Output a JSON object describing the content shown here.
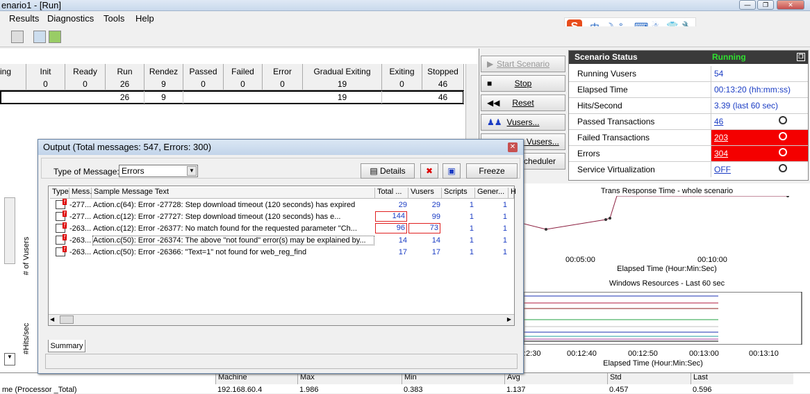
{
  "window": {
    "title": "enario1 - [Run]"
  },
  "menu": [
    "Results",
    "Diagnostics",
    "Tools",
    "Help"
  ],
  "ime": {
    "logo": "S",
    "chars": [
      "中",
      "☽",
      "°,",
      "⌨",
      "☃",
      "👕",
      "🔧"
    ]
  },
  "groups": {
    "columns": [
      {
        "name": "ing",
        "value": ""
      },
      {
        "name": "Init",
        "value": "0"
      },
      {
        "name": "Ready",
        "value": "0"
      },
      {
        "name": "Run",
        "value": "26"
      },
      {
        "name": "Rendez",
        "value": "9"
      },
      {
        "name": "Passed",
        "value": "0"
      },
      {
        "name": "Failed",
        "value": "0"
      },
      {
        "name": "Error",
        "value": "0"
      },
      {
        "name": "Gradual Exiting",
        "value": "19"
      },
      {
        "name": "Exiting",
        "value": "0"
      },
      {
        "name": "Stopped",
        "value": "46"
      }
    ],
    "row": {
      "run": "26",
      "rendez": "9",
      "gradual": "19",
      "stopped": "46"
    }
  },
  "controls": {
    "start": "Start Scenario",
    "stop": "Stop",
    "reset": "Reset",
    "vusers": "Vusers...",
    "runstop": "op Vusers...",
    "scheduler": "Scheduler"
  },
  "status": {
    "title": "Scenario Status",
    "state": "Running",
    "rows": [
      {
        "key": "Running Vusers",
        "val": "54"
      },
      {
        "key": "Elapsed Time",
        "val": "00:13:20 (hh:mm:ss)"
      },
      {
        "key": "Hits/Second",
        "val": "3.39 (last 60 sec)"
      },
      {
        "key": "Passed Transactions",
        "val": "46"
      },
      {
        "key": "Failed Transactions",
        "val": "203"
      },
      {
        "key": "Errors",
        "val": "304"
      },
      {
        "key": "Service Virtualization",
        "val": "OFF"
      }
    ]
  },
  "left": {
    "vusers_label": "# of Vusers",
    "hits_label": "#Hits/sec"
  },
  "graph1": {
    "title": "Trans Response Time - whole scenario",
    "ticks": [
      "00:05:00",
      "00:10:00"
    ],
    "xlabel": "Elapsed Time (Hour:Min:Sec)"
  },
  "graph2": {
    "title": "Windows Resources - Last 60 sec",
    "ticks": [
      ":2:30",
      "00:12:40",
      "00:12:50",
      "00:13:00",
      "00:13:10"
    ],
    "xlabel": "Elapsed Time (Hour:Min:Sec)"
  },
  "output": {
    "title": "Output (Total messages: 547,  Errors: 300)",
    "type_label": "Type of Message:",
    "type_value": "Errors",
    "details": "Details",
    "freeze": "Freeze",
    "headers": [
      "Type",
      "Mess...",
      "Sample Message Text",
      "Total ...",
      "Vusers",
      "Scripts",
      "Gener...",
      "H"
    ],
    "rows": [
      {
        "id": "-277...",
        "text": "Action.c(64): Error -27728: Step download timeout (120 seconds) has expired",
        "total": "29",
        "vusers": "29",
        "scripts": "1",
        "gen": "1"
      },
      {
        "id": "-277...",
        "text": "Action.c(12): Error -27727: Step download timeout (120 seconds) has e...",
        "total": "144",
        "vusers": "99",
        "scripts": "1",
        "gen": "1"
      },
      {
        "id": "-263...",
        "text": "Action.c(12): Error -26377: No match found for the requested parameter \"Ch...",
        "total": "96",
        "vusers": "73",
        "scripts": "1",
        "gen": "1"
      },
      {
        "id": "-263...",
        "text": "Action.c(50): Error -26374: The above \"not found\" error(s) may be explained by...",
        "total": "14",
        "vusers": "14",
        "scripts": "1",
        "gen": "1"
      },
      {
        "id": "-263...",
        "text": "Action.c(50): Error -26366: \"Text=1\" not found for web_reg_find",
        "total": "17",
        "vusers": "17",
        "scripts": "1",
        "gen": "1"
      }
    ],
    "tab": "Summary"
  },
  "measures": {
    "headers": [
      "Machine",
      "Max",
      "Min",
      "Avg",
      "Std",
      "Last"
    ],
    "row": {
      "name": "me (Processor _Total)",
      "machine": "192.168.60.4",
      "max": "1.986",
      "min": "0.383",
      "avg": "1.137",
      "std": "0.457",
      "last": "0.596"
    }
  }
}
